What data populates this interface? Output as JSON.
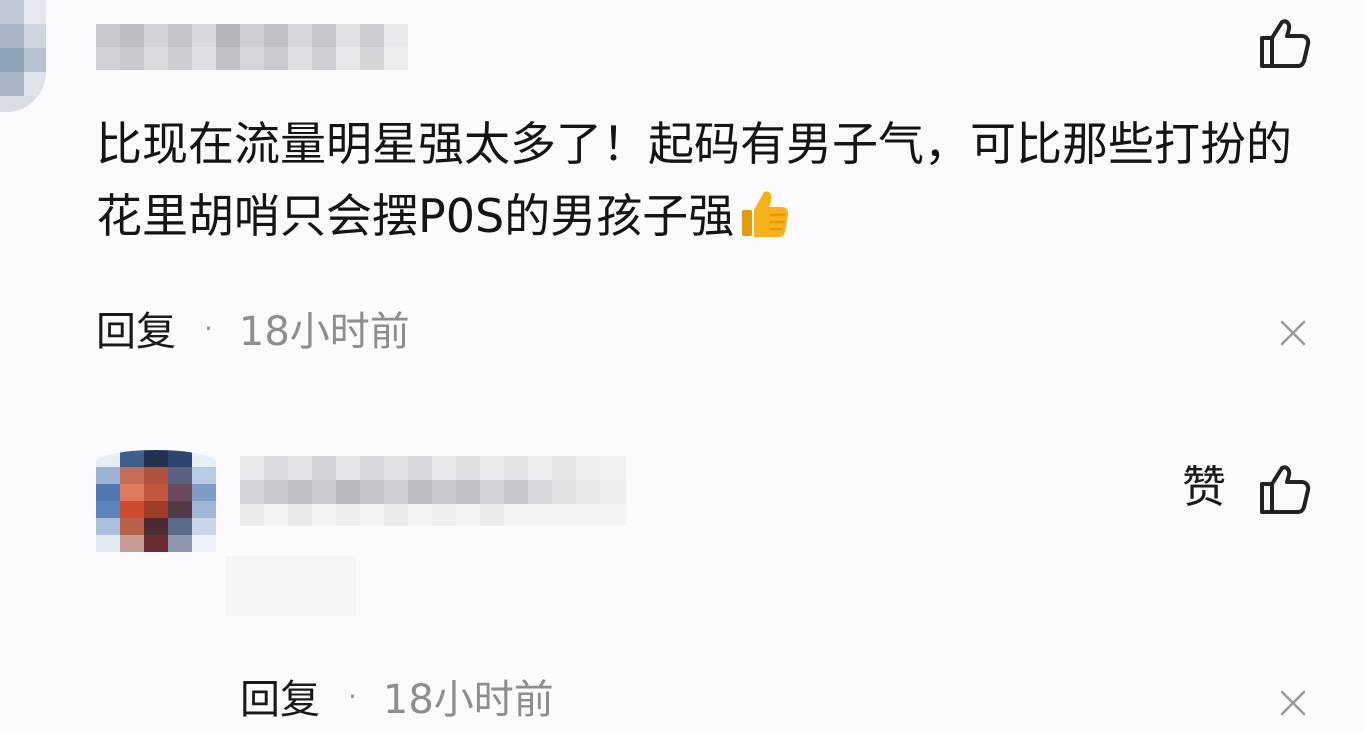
{
  "comments": [
    {
      "text": "比现在流量明星强太多了！起码有男子气，可比那些打扮的花里胡哨只会摆P0S的男孩子强",
      "emoji": "thumbs-up",
      "reply_label": "回复",
      "separator": "·",
      "time": "18小时前",
      "like_icon": "thumbs-up-outline-icon",
      "dismiss_icon": "close-icon"
    },
    {
      "like_label": "赞",
      "reply_label": "回复",
      "separator": "·",
      "time": "18小时前",
      "like_icon": "thumbs-up-outline-icon",
      "dismiss_icon": "close-icon"
    }
  ],
  "colors": {
    "background": "#fbfbfd",
    "text": "#141414",
    "muted": "#8e8e8e",
    "icon": "#222222",
    "close": "#9a9a9a",
    "emoji": "#f6b21b"
  }
}
